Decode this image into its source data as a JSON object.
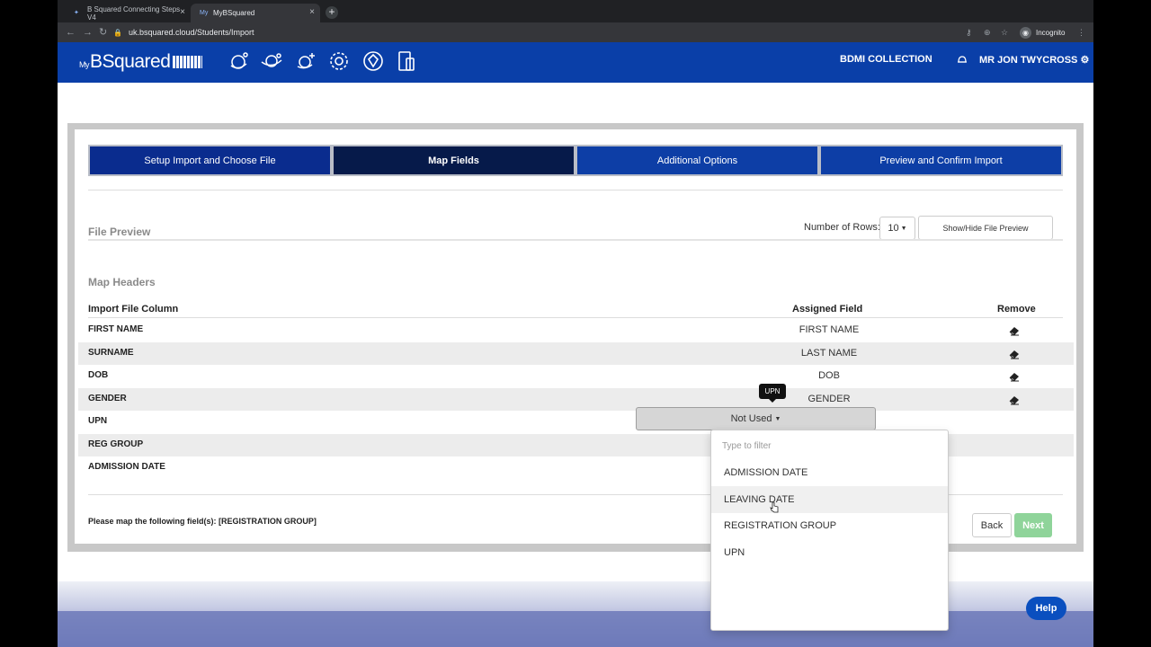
{
  "browser": {
    "tabs": [
      {
        "label": "B Squared Connecting Steps V4",
        "active": false
      },
      {
        "label": "MyBSquared",
        "active": true
      }
    ],
    "url": "uk.bsquared.cloud/Students/Import",
    "incognito_label": "Incognito"
  },
  "header": {
    "logo_prefix": "My",
    "logo_text": "BSquared",
    "nav_collection": "BDMI COLLECTION",
    "user_name": "MR JON TWYCROSS",
    "accent": "#0a3fa8"
  },
  "steps": [
    {
      "label": "Setup Import and Choose File",
      "active": false
    },
    {
      "label": "Map Fields",
      "active": true
    },
    {
      "label": "Additional Options",
      "active": false
    },
    {
      "label": "Preview and Confirm Import",
      "active": false
    }
  ],
  "file_preview": {
    "title": "File Preview",
    "rows_label": "Number of Rows:",
    "rows_value": "10",
    "toggle_button": "Show/Hide File Preview"
  },
  "map_headers": {
    "title": "Map Headers",
    "columns": {
      "import": "Import File Column",
      "assigned": "Assigned Field",
      "remove": "Remove"
    },
    "rows": [
      {
        "column": "FIRST NAME",
        "field": "FIRST NAME"
      },
      {
        "column": "SURNAME",
        "field": "LAST NAME"
      },
      {
        "column": "DOB",
        "field": "DOB"
      },
      {
        "column": "GENDER",
        "field": "GENDER"
      },
      {
        "column": "UPN",
        "field": ""
      },
      {
        "column": "REG GROUP",
        "field": ""
      },
      {
        "column": "ADMISSION DATE",
        "field": ""
      }
    ],
    "select_value": "Not Used",
    "tooltip": "UPN"
  },
  "dropdown": {
    "filter_placeholder": "Type to filter",
    "items": [
      "ADMISSION DATE",
      "LEAVING DATE",
      "REGISTRATION GROUP",
      "UPN"
    ],
    "hovered": "LEAVING DATE"
  },
  "footer_bar": {
    "message": "Please map the following field(s): [REGISTRATION GROUP]",
    "back": "Back",
    "next": "Next"
  },
  "help": "Help"
}
